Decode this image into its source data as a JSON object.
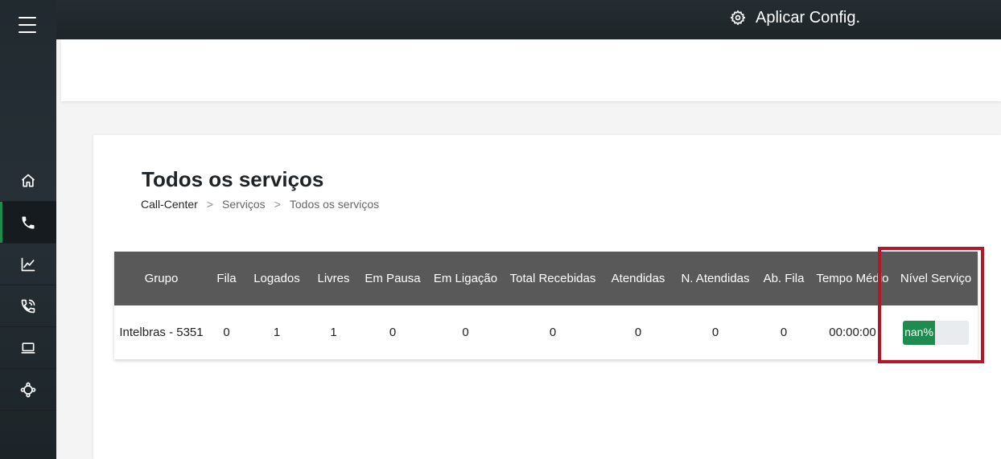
{
  "topbar": {
    "apply_config_label": "Aplicar Config.",
    "apply_config_icon": "gear-icon"
  },
  "sidebar": {
    "menu_icon": "hamburger-menu-icon",
    "items": [
      {
        "id": "home",
        "icon": "home-icon",
        "active": false
      },
      {
        "id": "call-center",
        "icon": "phone-icon",
        "active": true
      },
      {
        "id": "reports",
        "icon": "line-chart-icon",
        "active": false
      },
      {
        "id": "calls",
        "icon": "phone-ringing-icon",
        "active": false
      },
      {
        "id": "devices",
        "icon": "laptop-icon",
        "active": false
      },
      {
        "id": "integrations",
        "icon": "network-nodes-icon",
        "active": false
      }
    ]
  },
  "page": {
    "title": "Todos os serviços",
    "breadcrumb": [
      "Call-Center",
      "Serviços",
      "Todos os serviços"
    ],
    "breadcrumb_separator": ">"
  },
  "table": {
    "columns": [
      "Grupo",
      "Fila",
      "Logados",
      "Livres",
      "Em Pausa",
      "Em Ligação",
      "Total Recebidas",
      "Atendidas",
      "N. Atendidas",
      "Ab. Fila",
      "Tempo Médio",
      "Nível Serviço"
    ],
    "rows": [
      {
        "grupo": "Intelbras - 5351",
        "fila": "0",
        "logados": "1",
        "livres": "1",
        "em_pausa": "0",
        "em_ligacao": "0",
        "total_recebidas": "0",
        "atendidas": "0",
        "n_atendidas": "0",
        "ab_fila": "0",
        "tempo_medio": "00:00:00",
        "nivel_servico": "nan%"
      }
    ]
  },
  "colors": {
    "accent_green": "#1e8b4f",
    "highlight_red": "#b3172a",
    "table_header": "#595959"
  }
}
